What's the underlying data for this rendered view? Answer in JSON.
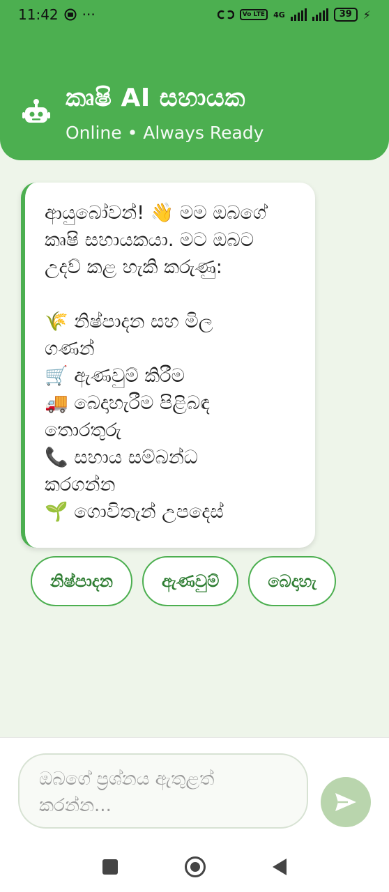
{
  "status_bar": {
    "time": "11:42",
    "more": "···",
    "network_box": "Vo LTE",
    "network_type": "4G",
    "battery": "39"
  },
  "header": {
    "title": "කෘෂි AI සහායක",
    "subtitle": "Online • Always Ready",
    "avatar_icon": "robot-icon"
  },
  "message": {
    "lines": [
      "ආයුබෝවන්! 👋 මම ඔබගේ",
      "කෘෂි සහායකයා. මට ඔබට",
      "උදව් කළ හැකි කරුණු:",
      "",
      "🌾 නිෂ්පාදන සහ මිල",
      "ගණන්",
      "🛒 ඇණවුම් කිරීම",
      "🚚 බෙදාහැරීම පිළිබඳ",
      "තොරතුරු",
      "📞 සහාය සම්බන්ධ",
      "කරගන්න",
      "🌱 ගොවිතැන් උපදෙස්"
    ]
  },
  "quick_replies": [
    "නිෂ්පාදන",
    "ඇණවුම්",
    "බෙදාහැ"
  ],
  "input": {
    "placeholder_line1": "ඔබගේ ප්‍රශ්නය ඇතුළත්",
    "placeholder_line2": "කරන්න...",
    "send_icon": "send-icon"
  },
  "colors": {
    "brand": "#4caf50",
    "background": "#eef5ea",
    "send_button": "#b9d5ad"
  }
}
